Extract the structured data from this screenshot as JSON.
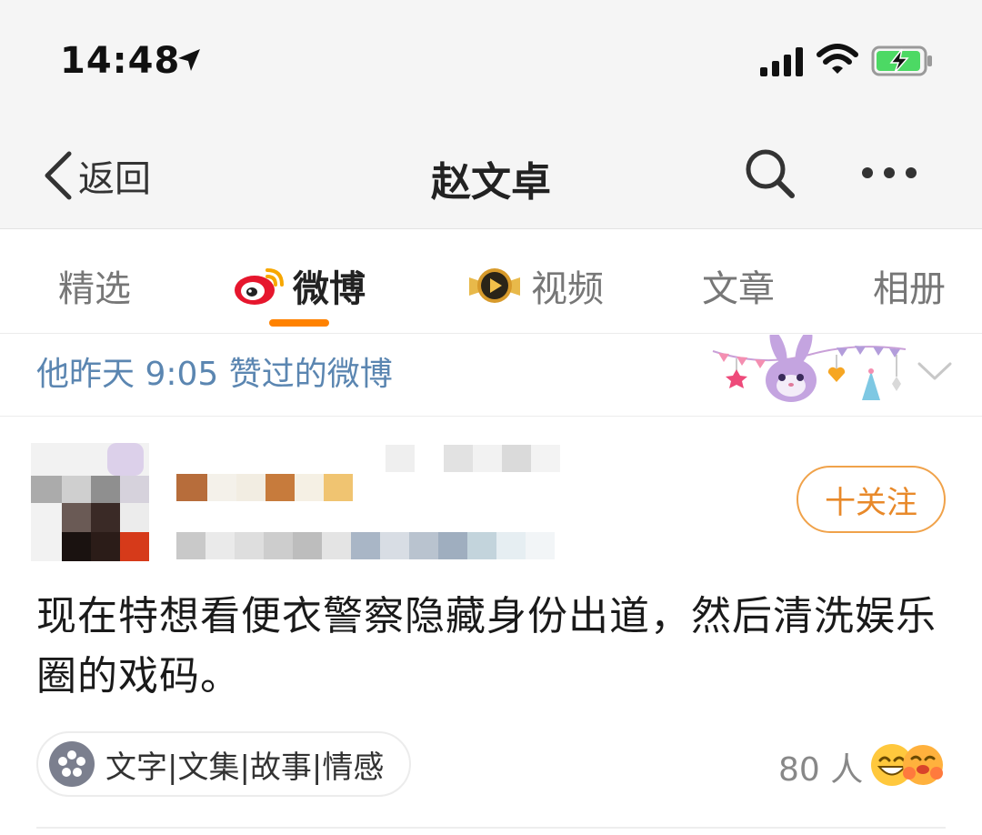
{
  "status_bar": {
    "time": "14:48",
    "icons": [
      "location-arrow-icon",
      "cellular-signal-icon",
      "wifi-icon",
      "battery-charging-icon"
    ],
    "battery_color": "#4cd964"
  },
  "nav": {
    "back_label": "返回",
    "title": "赵文卓",
    "icons": [
      "chevron-left-icon",
      "search-icon",
      "more-icon"
    ]
  },
  "tabs": [
    {
      "label": "精选",
      "active": false
    },
    {
      "label": "微博",
      "active": true,
      "icon": "weibo-logo-icon"
    },
    {
      "label": "视频",
      "active": false,
      "icon": "video-badge-icon"
    },
    {
      "label": "文章",
      "active": false
    },
    {
      "label": "相册",
      "active": false
    }
  ],
  "accent_color": "#ff8200",
  "like_banner": {
    "text": "他昨天 9:05 赞过的微博",
    "decoration": "bunny-party-garland",
    "icon": "chevron-down-icon",
    "text_color": "#5b86b1"
  },
  "post": {
    "avatar": "blurred-avatar",
    "username_redacted": true,
    "follow_label": "十关注",
    "text": "现在特想看便衣警察隐藏身份出道，然后清洗娱乐圈的戏码。",
    "topic": {
      "label": "文字|文集|故事|情感",
      "icon": "flower-icon"
    },
    "like_count": "80 人",
    "reaction_icons": [
      "laughing-emoji-icon",
      "hugging-emoji-icon"
    ]
  }
}
